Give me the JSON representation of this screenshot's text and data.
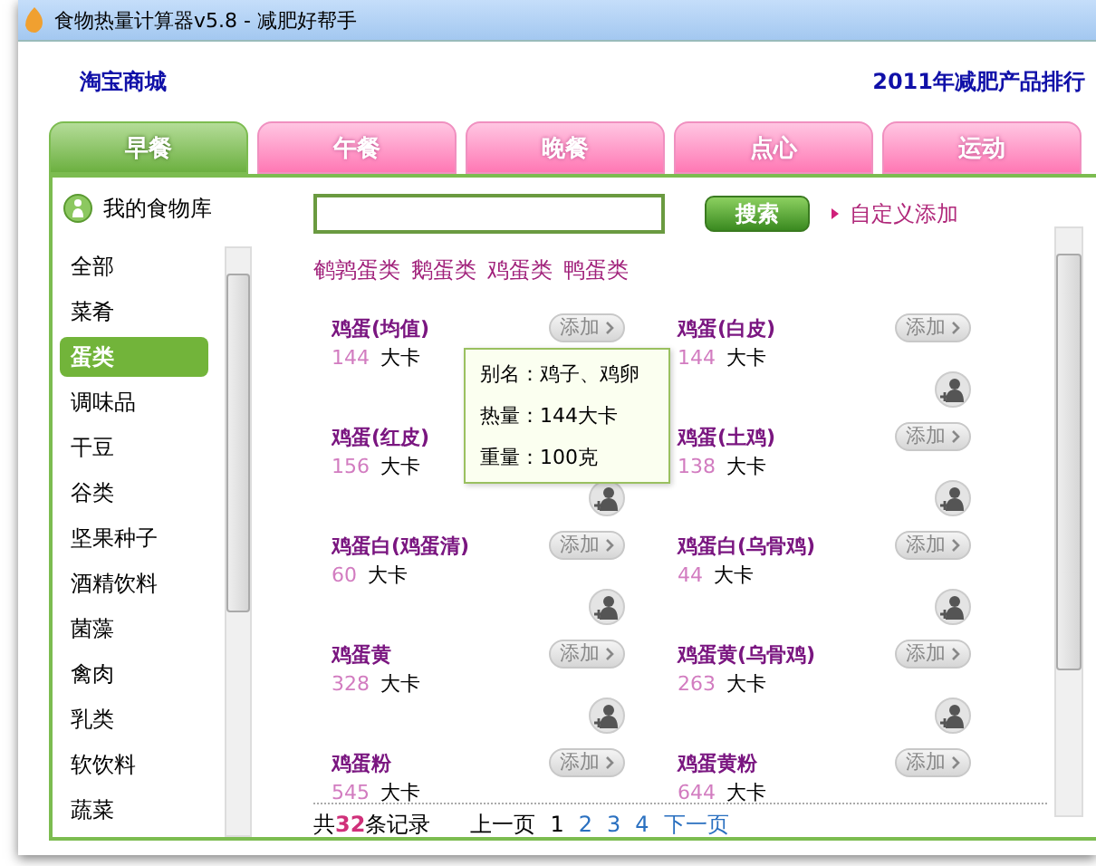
{
  "window": {
    "title": "食物热量计算器v5.8 - 减肥好帮手"
  },
  "header": {
    "left_link": "淘宝商城",
    "right_link": "2011年减肥产品排行"
  },
  "tabs": [
    {
      "label": "早餐",
      "selected": true
    },
    {
      "label": "午餐",
      "selected": false
    },
    {
      "label": "晚餐",
      "selected": false
    },
    {
      "label": "点心",
      "selected": false
    },
    {
      "label": "运动",
      "selected": false
    }
  ],
  "sidebar": {
    "title": "我的食物库",
    "items": [
      {
        "label": "全部",
        "selected": false
      },
      {
        "label": "菜肴",
        "selected": false
      },
      {
        "label": "蛋类",
        "selected": true
      },
      {
        "label": "调味品",
        "selected": false
      },
      {
        "label": "干豆",
        "selected": false
      },
      {
        "label": "谷类",
        "selected": false
      },
      {
        "label": "坚果种子",
        "selected": false
      },
      {
        "label": "酒精饮料",
        "selected": false
      },
      {
        "label": "菌藻",
        "selected": false
      },
      {
        "label": "禽肉",
        "selected": false
      },
      {
        "label": "乳类",
        "selected": false
      },
      {
        "label": "软饮料",
        "selected": false
      },
      {
        "label": "蔬菜",
        "selected": false
      }
    ]
  },
  "search": {
    "button": "搜索",
    "custom_add": "自定义添加"
  },
  "subcategories": [
    "鹌鹑蛋类",
    "鹅蛋类",
    "鸡蛋类",
    "鸭蛋类"
  ],
  "foods": [
    {
      "name": "鸡蛋(均值)",
      "calories": "144",
      "unit": "大卡",
      "button": "添加",
      "member_icon": false
    },
    {
      "name": "鸡蛋(白皮)",
      "calories": "144",
      "unit": "大卡",
      "button": "添加",
      "member_icon": true
    },
    {
      "name": "鸡蛋(红皮)",
      "calories": "156",
      "unit": "大卡",
      "member_icon": true
    },
    {
      "name": "鸡蛋(土鸡)",
      "calories": "138",
      "unit": "大卡",
      "button": "添加",
      "member_icon": true
    },
    {
      "name": "鸡蛋白(鸡蛋清)",
      "calories": "60",
      "unit": "大卡",
      "button": "添加",
      "member_icon": true
    },
    {
      "name": "鸡蛋白(乌骨鸡)",
      "calories": "44",
      "unit": "大卡",
      "button": "添加",
      "member_icon": true
    },
    {
      "name": "鸡蛋黄",
      "calories": "328",
      "unit": "大卡",
      "button": "添加",
      "member_icon": true
    },
    {
      "name": "鸡蛋黄(乌骨鸡)",
      "calories": "263",
      "unit": "大卡",
      "button": "添加",
      "member_icon": true
    },
    {
      "name": "鸡蛋粉",
      "calories": "545",
      "unit": "大卡",
      "button": "添加",
      "member_icon": false
    },
    {
      "name": "鸡蛋黄粉",
      "calories": "644",
      "unit": "大卡",
      "button": "添加",
      "member_icon": false
    }
  ],
  "tooltip": {
    "alias": "别名：鸡子、鸡卵",
    "heat": "热量：144大卡",
    "weight": "重量：100克"
  },
  "pagination": {
    "total": "共**32**条记录",
    "prev": "上一页",
    "pages": [
      {
        "label": "1",
        "selected": true
      },
      {
        "label": "2",
        "selected": false
      },
      {
        "label": "3",
        "selected": false
      },
      {
        "label": "4",
        "selected": false
      }
    ],
    "next": "下一页"
  }
}
